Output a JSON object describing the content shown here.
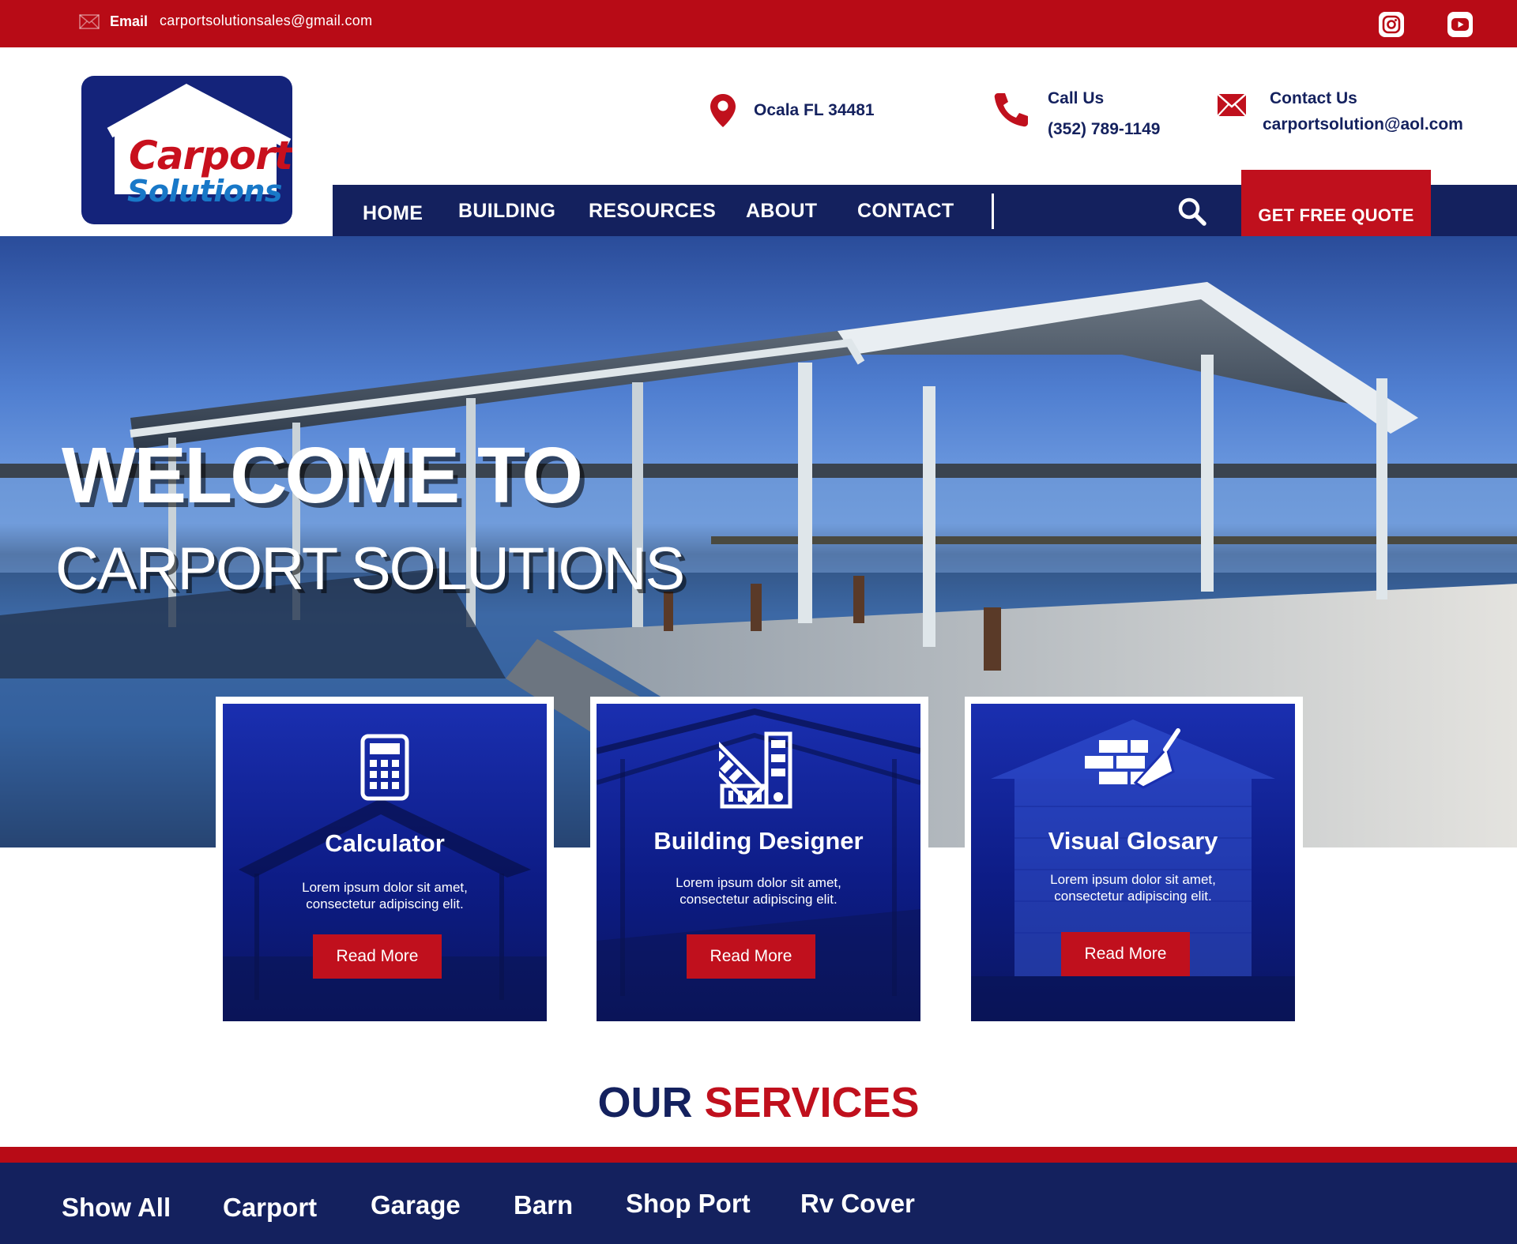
{
  "topbar": {
    "email_label": "Email",
    "email_value": "carportsolutionsales@gmail.com",
    "icons": [
      "mail-icon",
      "instagram-icon",
      "youtube-icon"
    ]
  },
  "logo": {
    "line1": "Carport",
    "line2": "Solutions"
  },
  "header": {
    "address": "Ocala FL 34481",
    "call_label": "Call Us",
    "call_value": "(352) 789-1149",
    "contact_label": "Contact Us",
    "contact_value": "carportsolution@aol.com"
  },
  "nav": {
    "items": [
      "HOME",
      "BUILDING",
      "RESOURCES",
      "ABOUT",
      "CONTACT"
    ],
    "quote_label": "GET FREE QUOTE"
  },
  "hero": {
    "title1": "WELCOME TO",
    "title2": "CARPORT SOLUTIONS"
  },
  "cards": [
    {
      "title": "Calculator",
      "text": "Lorem ipsum dolor sit amet, consectetur adipiscing elit.",
      "button": "Read More",
      "icon": "calculator-icon"
    },
    {
      "title": "Building Designer",
      "text": "Lorem ipsum dolor sit amet, consectetur adipiscing elit.",
      "button": "Read More",
      "icon": "swatch-icon"
    },
    {
      "title": "Visual Glosary",
      "text": "Lorem ipsum dolor sit amet, consectetur adipiscing elit.",
      "button": "Read More",
      "icon": "brick-trowel-icon"
    }
  ],
  "services": {
    "title_a": "OUR",
    "title_b": "SERVICES",
    "tabs": [
      "Show All",
      "Carport",
      "Garage",
      "Barn",
      "Shop Port",
      "Rv Cover"
    ]
  },
  "colors": {
    "brand_red": "#b80b16",
    "brand_navy": "#14215e",
    "card_blue": "#1a2fb0"
  }
}
